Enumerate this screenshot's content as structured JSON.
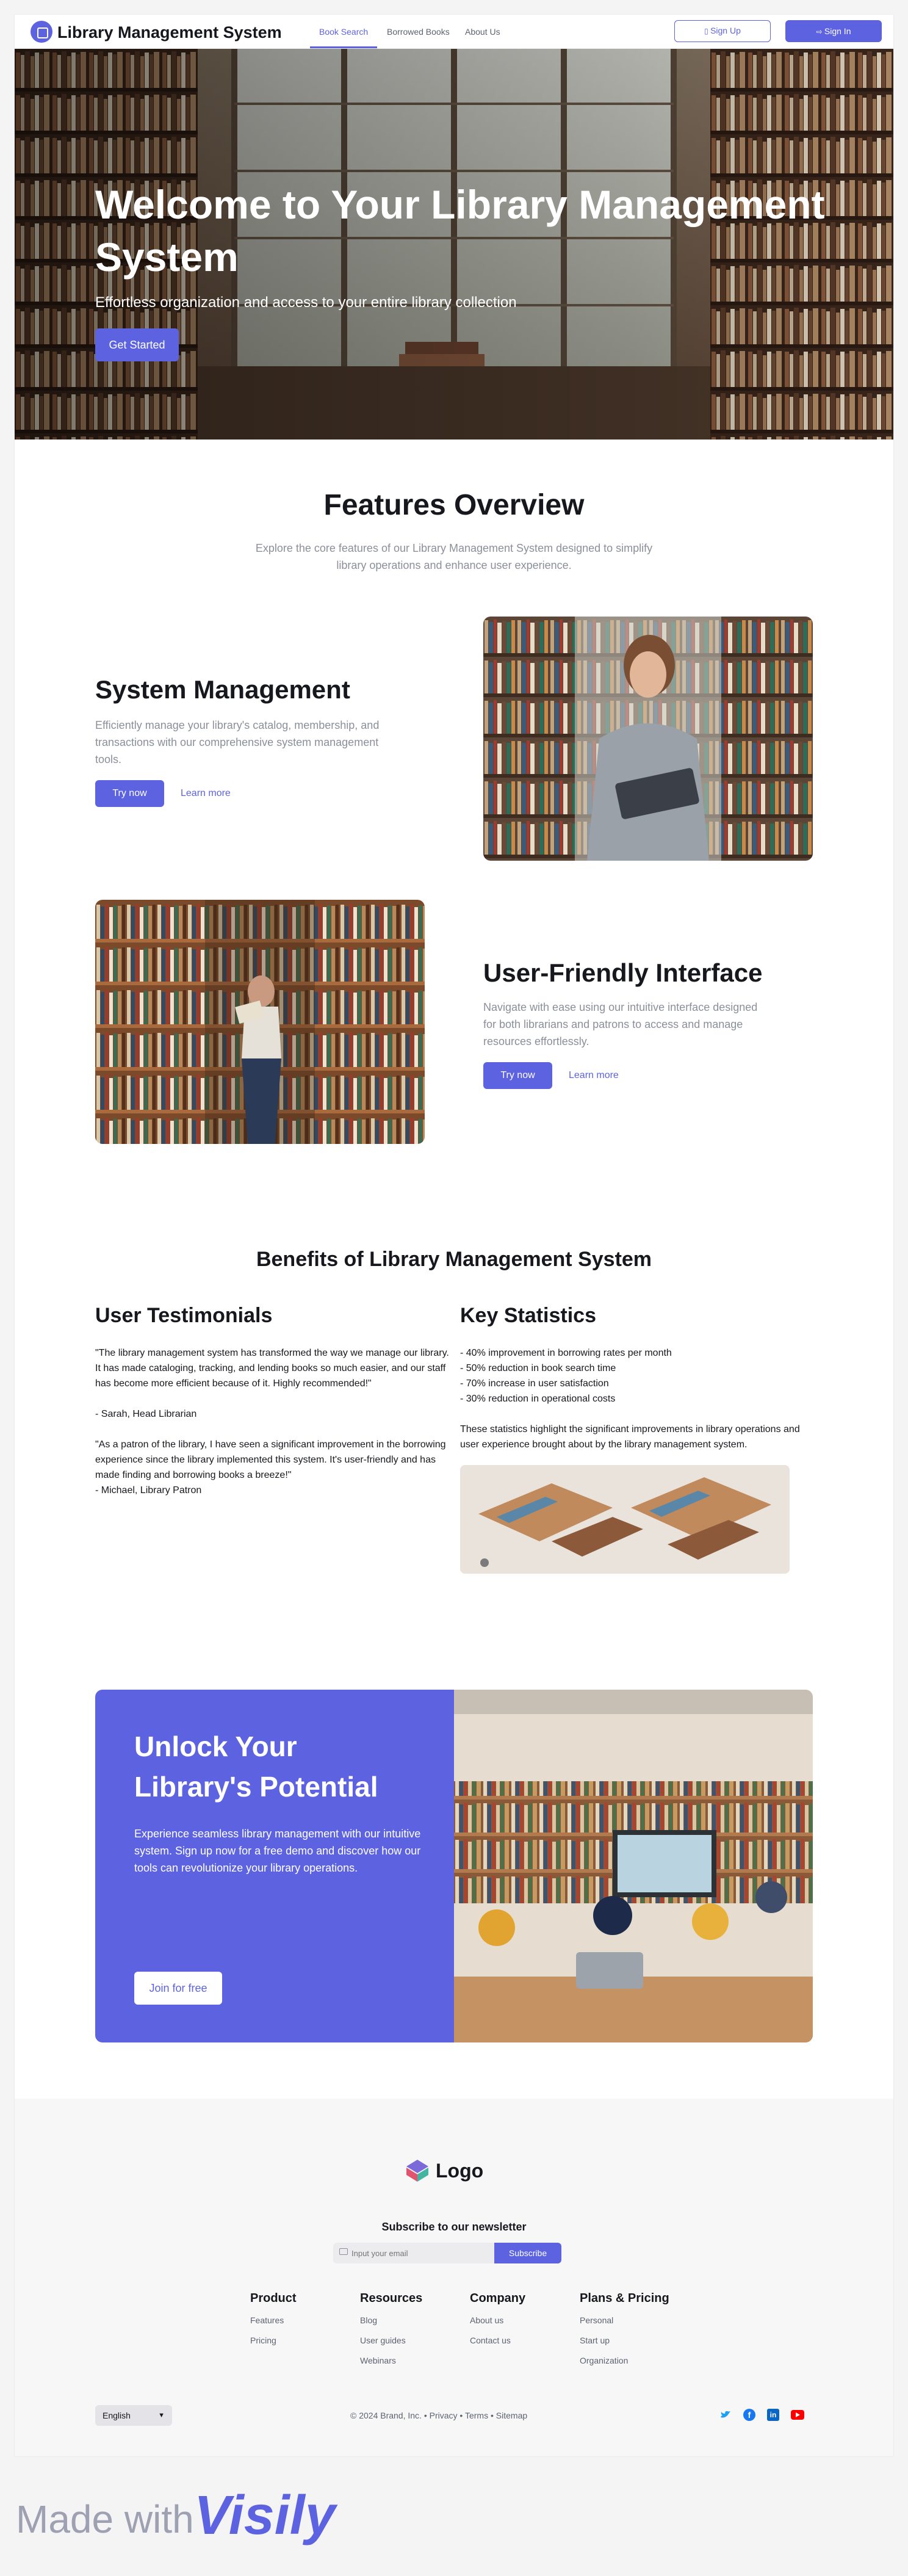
{
  "header": {
    "brand": "Library Management System",
    "nav": [
      "Book Search",
      "Borrowed Books",
      "About Us"
    ],
    "signup": "Sign Up",
    "signin": "Sign In"
  },
  "hero": {
    "title": "Welcome to Your Library Management System",
    "subtitle": "Effortless organization and access to your entire library collection",
    "cta": "Get Started"
  },
  "features": {
    "title": "Features Overview",
    "subtitle": "Explore the core features of our Library Management System designed to simplify library operations and enhance user experience.",
    "items": [
      {
        "title": "System Management",
        "text": "Efficiently manage your library's catalog, membership, and transactions with our comprehensive system management tools.",
        "try": "Try now",
        "learn": "Learn more"
      },
      {
        "title": "User-Friendly Interface",
        "text": "Navigate with ease using our intuitive interface designed for both librarians and patrons to access and manage resources effortlessly.",
        "try": "Try now",
        "learn": "Learn more"
      }
    ]
  },
  "benefits": {
    "title": "Benefits of Library Management System",
    "testimonials_title": "User Testimonials",
    "testimonials": [
      {
        "quote": "\"The library management system has transformed the way we manage our library. It has made cataloging, tracking, and lending books so much easier, and our staff has become more efficient because of it. Highly recommended!\"",
        "author": " - Sarah, Head Librarian"
      },
      {
        "quote": "\"As a patron of the library, I have seen a significant improvement in the borrowing experience since the library implemented this system. It's user-friendly and has made finding and borrowing books a breeze!\"",
        "author": " - Michael, Library Patron"
      }
    ],
    "stats_title": "Key Statistics",
    "stats": [
      "- 40% improvement in borrowing rates per month",
      "- 50% reduction in book search time",
      "- 70% increase in user satisfaction",
      "- 30% reduction in operational costs"
    ],
    "stats_note": "These statistics highlight the significant improvements in library operations and user experience brought about by the library management system."
  },
  "cta": {
    "title": "Unlock Your Library's Potential",
    "text": "Experience seamless library management with our intuitive system. Sign up now for a free demo and discover how our tools can revolutionize your library operations.",
    "button": "Join for free"
  },
  "footer": {
    "logo": "Logo",
    "newsletter": "Subscribe to our newsletter",
    "email_placeholder": "Input your email",
    "subscribe": "Subscribe",
    "columns": [
      {
        "title": "Product",
        "links": [
          "Features",
          "Pricing"
        ]
      },
      {
        "title": "Resources",
        "links": [
          "Blog",
          "User guides",
          "Webinars"
        ]
      },
      {
        "title": "Company",
        "links": [
          "About us",
          "Contact us"
        ]
      },
      {
        "title": "Plans & Pricing",
        "links": [
          "Personal",
          "Start up",
          "Organization"
        ]
      }
    ],
    "language": "English",
    "copyright": "© 2024 Brand, Inc.",
    "legal": [
      "Privacy",
      "Terms",
      "Sitemap"
    ]
  },
  "madewith": {
    "text": "Made with",
    "brand": "Visily"
  },
  "colors": {
    "accent": "#5d63e0",
    "text": "#16181d",
    "muted": "#8b8f9a"
  }
}
